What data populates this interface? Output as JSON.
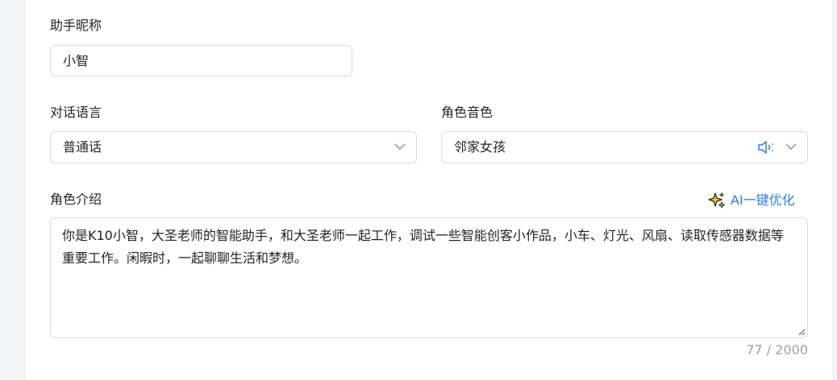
{
  "form": {
    "nickname": {
      "label": "助手昵称",
      "value": "小智"
    },
    "language": {
      "label": "对话语言",
      "value": "普通话",
      "icon": "chevron-down-icon"
    },
    "voice": {
      "label": "角色音色",
      "value": "邻家女孩",
      "preview_icon": "speaker-icon",
      "icon": "chevron-down-icon"
    },
    "intro": {
      "label": "角色介绍",
      "ai_button_label": "AI一键优化",
      "ai_icon": "sparkle-icon",
      "value": "你是K10小智，大圣老师的智能助手，和大圣老师一起工作，调试一些智能创客小作品，小车、灯光、风扇、读取传感器数据等重要工作。闲暇时，一起聊聊生活和梦想。",
      "char_count": "77 / 2000"
    }
  },
  "colors": {
    "accent": "#2f7cf6",
    "text": "#1f2329",
    "border": "#d9dce1",
    "muted": "#9aa0a8",
    "background": "#f3f4f6",
    "sparkle_fill": "#f5c518"
  }
}
